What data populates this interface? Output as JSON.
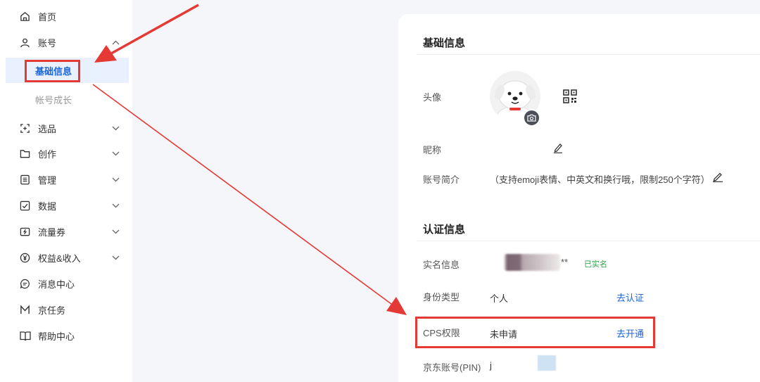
{
  "sidebar": {
    "items": [
      {
        "label": "首页",
        "icon": "home-icon"
      },
      {
        "label": "账号",
        "icon": "user-icon"
      },
      {
        "label": "选品",
        "icon": "select-product-icon"
      },
      {
        "label": "创作",
        "icon": "folder-icon"
      },
      {
        "label": "管理",
        "icon": "manage-icon"
      },
      {
        "label": "数据",
        "icon": "data-icon"
      },
      {
        "label": "流量券",
        "icon": "coupon-icon"
      },
      {
        "label": "权益&收入",
        "icon": "yen-icon"
      },
      {
        "label": "消息中心",
        "icon": "message-icon"
      },
      {
        "label": "京任务",
        "icon": "task-icon"
      },
      {
        "label": "帮助中心",
        "icon": "book-icon"
      }
    ],
    "account_sub": [
      {
        "label": "基础信息",
        "active": true
      },
      {
        "label": "帐号成长",
        "active": false
      }
    ]
  },
  "basic_info": {
    "title": "基础信息",
    "avatar_label": "头像",
    "nickname_label": "昵称",
    "bio_label": "账号简介",
    "bio_placeholder": "（支持emoji表情、中英文和换行哦，限制250个字符）"
  },
  "auth_info": {
    "title": "认证信息",
    "realname_label": "实名信息",
    "realname_masked": "**",
    "realname_badge": "已实名",
    "identity_label": "身份类型",
    "identity_value": "个人",
    "identity_action": "去认证",
    "cps_label": "CPS权限",
    "cps_value": "未申请",
    "cps_action": "去开通",
    "pin_label": "京东账号(PIN)",
    "pin_value": "j"
  },
  "colors": {
    "accent": "#1f63d6",
    "active_bg": "#e8f1fd",
    "annotation_red": "#e53935",
    "verified_green": "#2fa14a"
  }
}
